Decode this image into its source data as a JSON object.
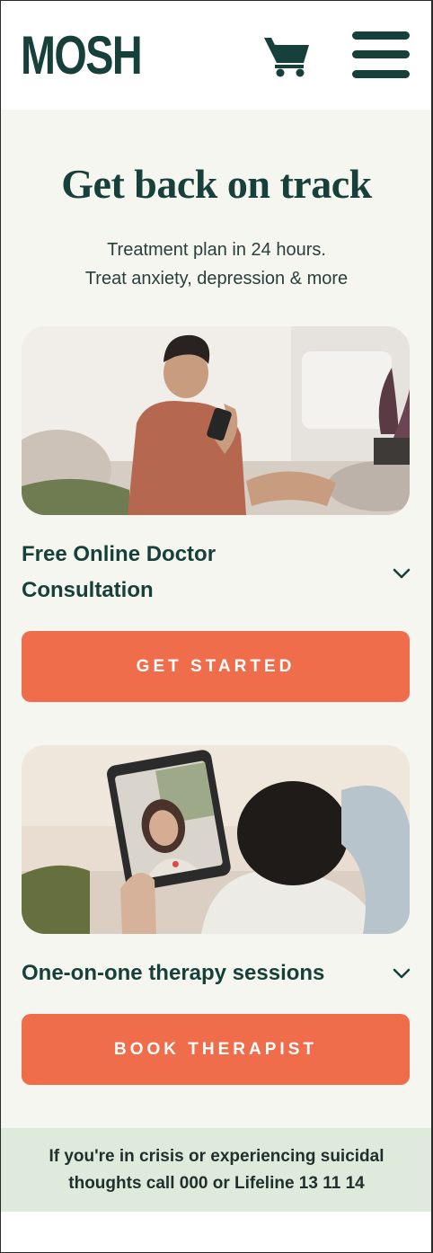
{
  "header": {
    "logo": "MOSH",
    "cart_icon": "cart-icon",
    "menu_icon": "hamburger-menu-icon"
  },
  "hero": {
    "title": "Get back on track",
    "subtitle_line1": "Treatment plan in 24 hours.",
    "subtitle_line2": "Treat anxiety, depression & more"
  },
  "cards": [
    {
      "heading_line1": "Free Online Doctor",
      "heading_line2": "Consultation",
      "button_label": "GET STARTED",
      "expand_icon": "chevron-down-icon"
    },
    {
      "heading": "One-on-one therapy sessions",
      "button_label": "BOOK THERAPIST",
      "expand_icon": "chevron-down-icon"
    }
  ],
  "crisis": {
    "text": "If you're in crisis or experiencing suicidal thoughts call 000 or Lifeline 13 11 14"
  },
  "colors": {
    "brand": "#17403a",
    "accent": "#ef6d4b",
    "background": "#f6f6f0",
    "banner": "#deeadb"
  }
}
